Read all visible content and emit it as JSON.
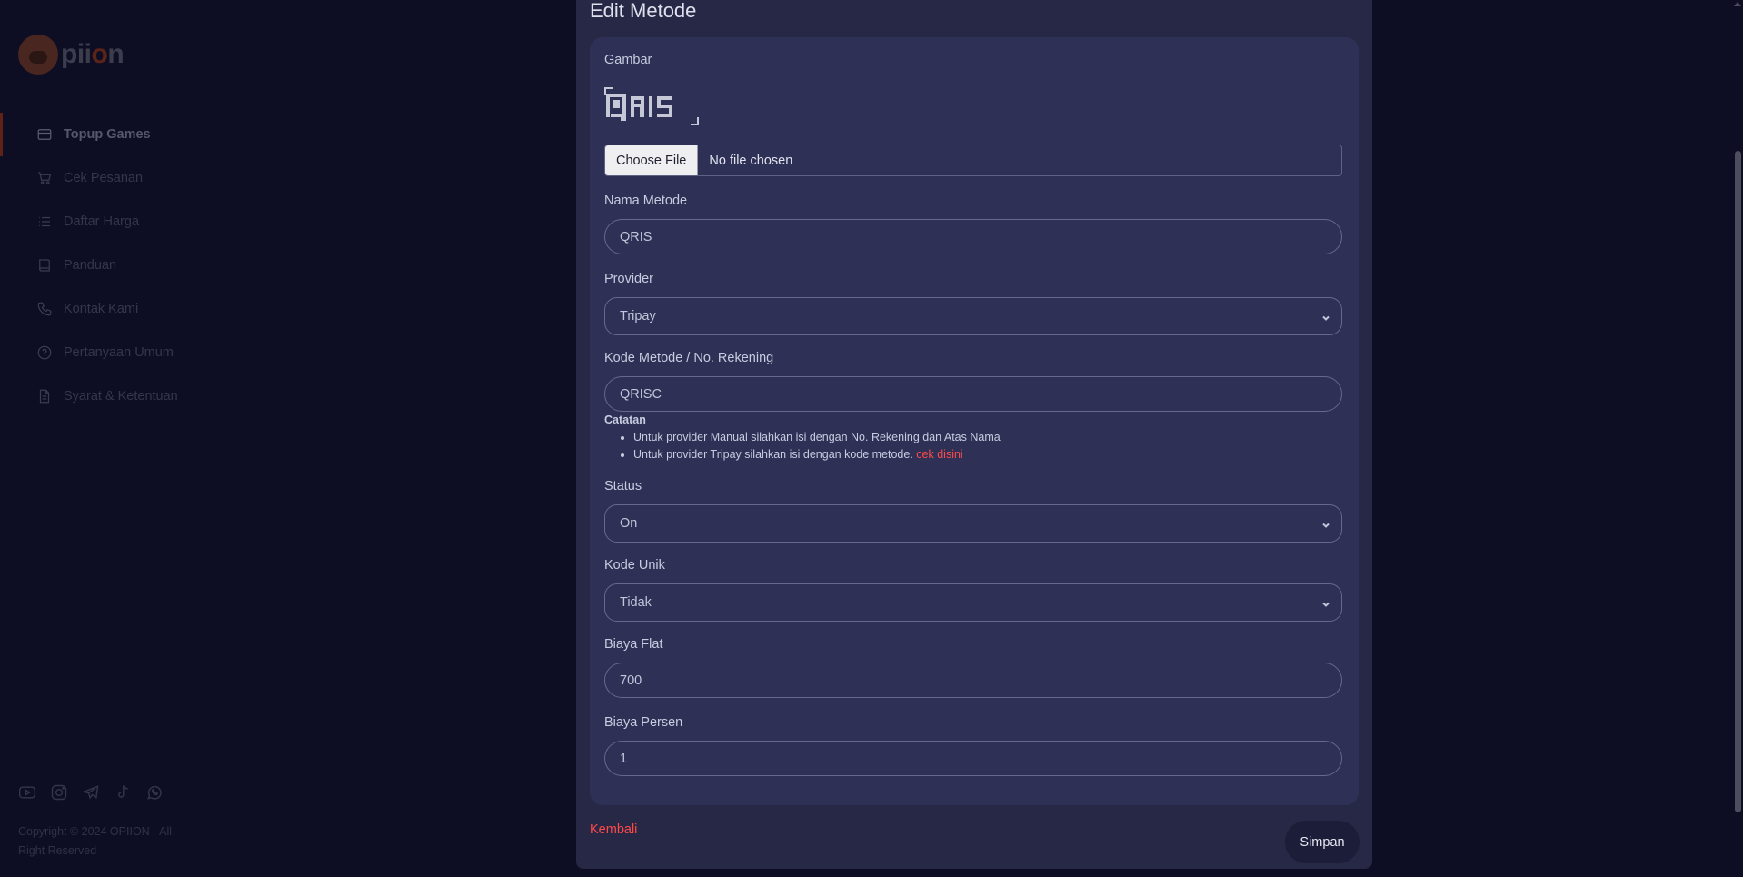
{
  "sidebar": {
    "logo_text_start": "pii",
    "logo_text_accent": "o",
    "logo_text_end": "n",
    "items": [
      {
        "label": "Topup Games",
        "icon": "credit-card-icon",
        "active": true
      },
      {
        "label": "Cek Pesanan",
        "icon": "cart-icon",
        "active": false
      },
      {
        "label": "Daftar Harga",
        "icon": "list-icon",
        "active": false
      },
      {
        "label": "Panduan",
        "icon": "book-icon",
        "active": false
      },
      {
        "label": "Kontak Kami",
        "icon": "phone-icon",
        "active": false
      },
      {
        "label": "Pertanyaan Umum",
        "icon": "question-circle-icon",
        "active": false
      },
      {
        "label": "Syarat & Ketentuan",
        "icon": "document-icon",
        "active": false
      }
    ],
    "socials": [
      "youtube-icon",
      "instagram-icon",
      "telegram-icon",
      "tiktok-icon",
      "whatsapp-icon"
    ],
    "copyright": "Copyright © 2024 OPIION - All Right Reserved"
  },
  "modal": {
    "title": "Edit Metode",
    "gambar_label": "Gambar",
    "image_alt": "QRIS",
    "file_button": "Choose File",
    "file_status": "No file chosen",
    "nama_label": "Nama Metode",
    "nama_value": "QRIS",
    "provider_label": "Provider",
    "provider_value": "Tripay",
    "kode_label": "Kode Metode / No. Rekening",
    "kode_value": "QRISC",
    "note_title": "Catatan",
    "note_1": "Untuk provider Manual silahkan isi dengan No. Rekening dan Atas Nama",
    "note_2": "Untuk provider Tripay silahkan isi dengan kode metode.",
    "note_link": "cek disini",
    "status_label": "Status",
    "status_value": "On",
    "unik_label": "Kode Unik",
    "unik_value": "Tidak",
    "flat_label": "Biaya Flat",
    "flat_value": "700",
    "persen_label": "Biaya Persen",
    "persen_value": "1",
    "back_label": "Kembali",
    "save_label": "Simpan"
  },
  "colors": {
    "background": "#0d0e23",
    "modal": "#262845",
    "card": "#2e3055",
    "link_red": "#ff4848"
  }
}
